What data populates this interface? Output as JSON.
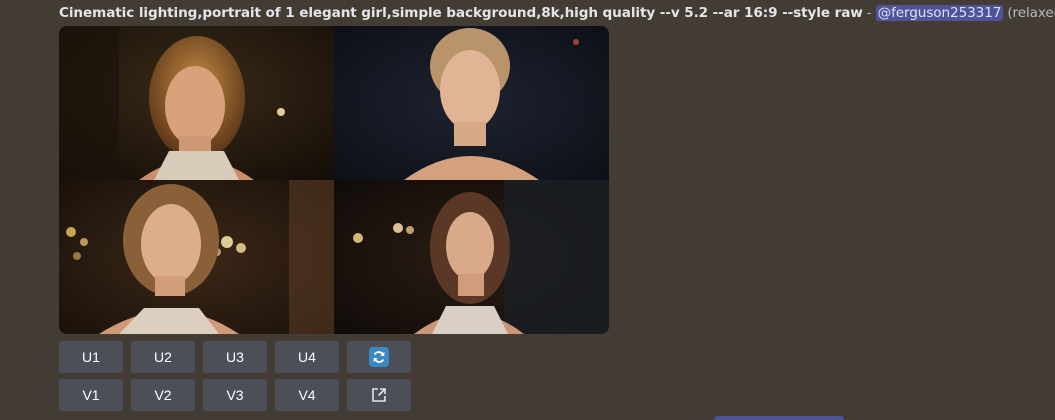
{
  "message": {
    "prompt": "Cinematic lighting,portrait of 1 elegant girl,simple background,8k,high quality --v 5.2 --ar 16:9 --style raw",
    "separator": "-",
    "mention": "@ferguson253317",
    "status": "(relaxed)"
  },
  "image_grid": {
    "tiles": [
      {
        "description": "portrait-1"
      },
      {
        "description": "portrait-2"
      },
      {
        "description": "portrait-3"
      },
      {
        "description": "portrait-4"
      }
    ]
  },
  "buttons": {
    "upscale": [
      "U1",
      "U2",
      "U3",
      "U4"
    ],
    "variation": [
      "V1",
      "V2",
      "V3",
      "V4"
    ],
    "reroll_icon": "refresh-icon",
    "open_icon": "external-link-icon"
  },
  "colors": {
    "background": "#423c35",
    "button": "#4c4f58",
    "mention_bg": "#4e5497",
    "refresh_blue": "#3b88c3"
  }
}
